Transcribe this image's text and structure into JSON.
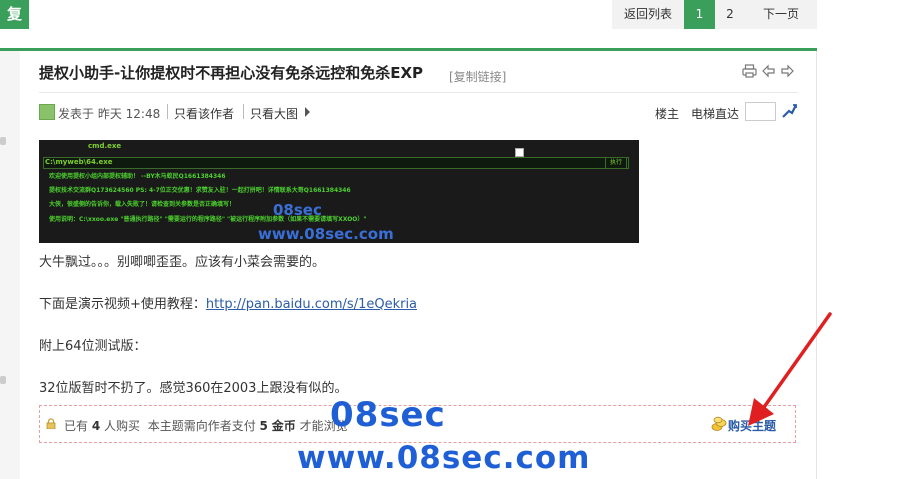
{
  "reply_tag": "复",
  "pager": {
    "back": "返回列表",
    "pages": [
      "1",
      "2"
    ],
    "current": "1",
    "next": "下一页"
  },
  "post": {
    "title": "提权小助手-让你提权时不再担心没有免杀远控和免杀EXP",
    "copy_link": "[复制链接]",
    "author_line": {
      "posted_at": "发表于 昨天 12:48",
      "only_author": "只看该作者",
      "only_big": "只看大图"
    },
    "floor": "楼主",
    "elevator": "电梯直达",
    "elevator_value": ""
  },
  "cmd_screenshot": {
    "window_title": "cmd.exe",
    "path": "C:\\myweb\\64.exe",
    "exec_button": "执行",
    "lines": [
      "欢迎使用提权小组内部提权辅助！ --BY木马蚁民Q1661384346",
      "提权技术交流群Q173624560 PS: 4-7位正交优惠！求赞友入驻！一起打拼吧！详情联系大哥Q1661384346",
      "大侠，很盛侧的告诉你，载入失败了！请检查到关参数是否正确填写！",
      "使用说明：C:\\xxoo.exe \"普通执行路径\" \"需要运行的程序路径\" \"被运行程序附加参数（如果不需要请填写XXOO）\""
    ],
    "logo": "08sec",
    "site": "www.08sec.com"
  },
  "body": {
    "line1": "大牛飘过。。。别唧唧歪歪。应该有小菜会需要的。",
    "line2_prefix": "下面是演示视频+使用教程：",
    "line2_link": "http://pan.baidu.com/s/1eQekria",
    "line3": "附上64位测试版：",
    "line4": "32位版暂时不扔了。感觉360在2003上跟没有似的。"
  },
  "purchase": {
    "already": "已有",
    "count": "4",
    "people_bought": "人购买",
    "requirement": "本主题需向作者支付",
    "price": "5",
    "currency": "金币",
    "tail": "才能浏览",
    "buy_button": "购买主题"
  },
  "watermark": {
    "logo": "08sec",
    "site": "www.08sec.com"
  },
  "colors": {
    "accent_green": "#3b9f5c",
    "link_blue": "#2a5ca8",
    "watermark_blue": "#1f5fd6",
    "arrow_red": "#e02020"
  },
  "icons": [
    "print-icon",
    "prev-icon",
    "next-icon",
    "user-avatar-icon",
    "elevator-go-icon",
    "lock-icon",
    "coin-icon",
    "red-arrow-icon"
  ]
}
